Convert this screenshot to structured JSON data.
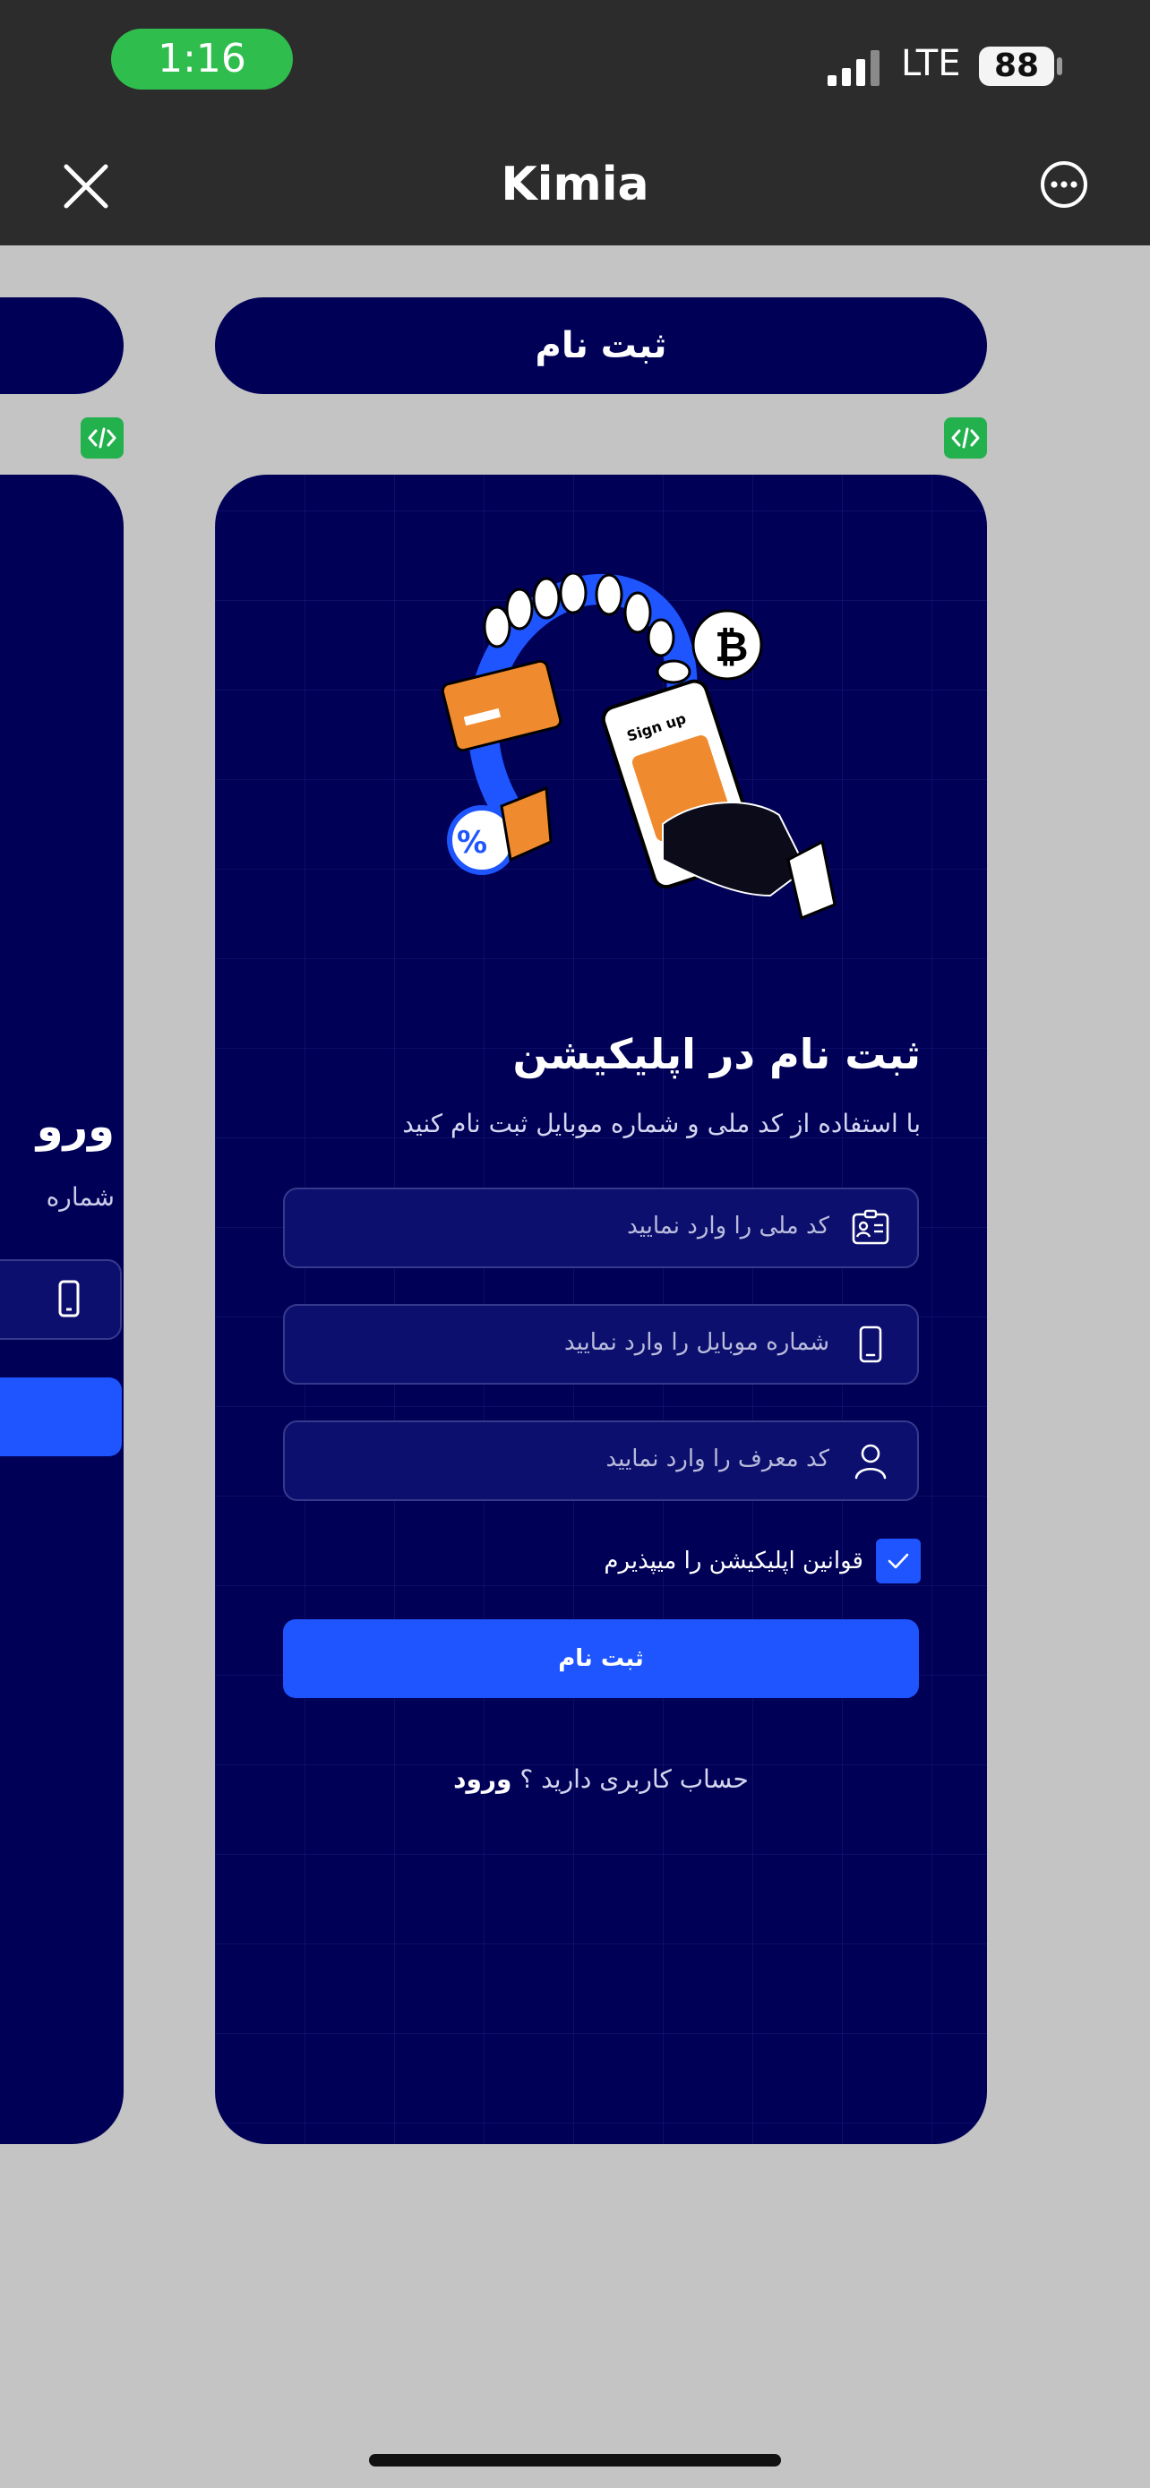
{
  "status_bar": {
    "time": "1:16",
    "network": "LTE",
    "battery": "88"
  },
  "nav": {
    "title": "Kimia"
  },
  "header": {
    "label": "ثبت نام"
  },
  "colors": {
    "card_bg": "#000057",
    "accent": "#1e55ff",
    "code_badge": "#22b14c",
    "chrome_bg": "#2c2c2c",
    "canvas_bg": "#c4c4c4"
  },
  "illustration": {
    "phone_text": "Sign up"
  },
  "left_card": {
    "heading": "ورو",
    "sub": "شماره"
  },
  "signup": {
    "title": "ثبت نام در اپلیکیشن",
    "subtitle": "با استفاده از کد ملی و شماره موبایل ثبت نام کنید",
    "fields": [
      {
        "icon": "id-card-icon",
        "placeholder": "کد ملی را وارد نمایید"
      },
      {
        "icon": "mobile-phone-icon",
        "placeholder": "شماره موبایل را وارد نمایید"
      },
      {
        "icon": "user-icon",
        "placeholder": "کد معرف را وارد نمایید"
      }
    ],
    "terms": {
      "checked": true,
      "label": "قوانین اپلیکیشن را میپذیرم"
    },
    "submit_label": "ثبت نام",
    "login_prompt": "حساب کاربری دارید ؟",
    "login_link": "ورود"
  }
}
